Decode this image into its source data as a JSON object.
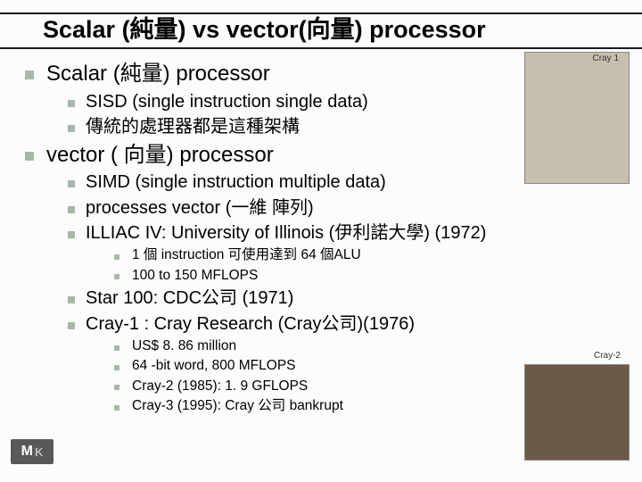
{
  "title": "Scalar (純量)  vs vector(向量) processor",
  "sections": [
    {
      "heading": "Scalar (純量) processor",
      "items": [
        "SISD (single instruction single data)",
        "傳統的處理器都是這種架構"
      ]
    },
    {
      "heading": "vector ( 向量) processor",
      "items": [
        "SIMD (single instruction multiple data)",
        "processes vector (一維 陣列)",
        "ILLIAC IV: University of Illinois (伊利諾大學) (1972)"
      ],
      "sub_illiac": [
        "1 個 instruction 可使用達到  64 個ALU",
        "100 to 150 MFLOPS"
      ],
      "items2": [
        "Star 100: CDC公司 (1971)",
        "Cray-1 : Cray Research (Cray公司)(1976)"
      ],
      "sub_cray": [
        "US$ 8. 86 million",
        "64 -bit word, 800 MFLOPS",
        "Cray-2 (1985): 1. 9 GFLOPS",
        "Cray-3 (1995): Cray 公司 bankrupt"
      ]
    }
  ],
  "captions": {
    "img1": "Cray 1",
    "img2": "Cray-2"
  },
  "logo": {
    "a": "M",
    "b": "K"
  }
}
